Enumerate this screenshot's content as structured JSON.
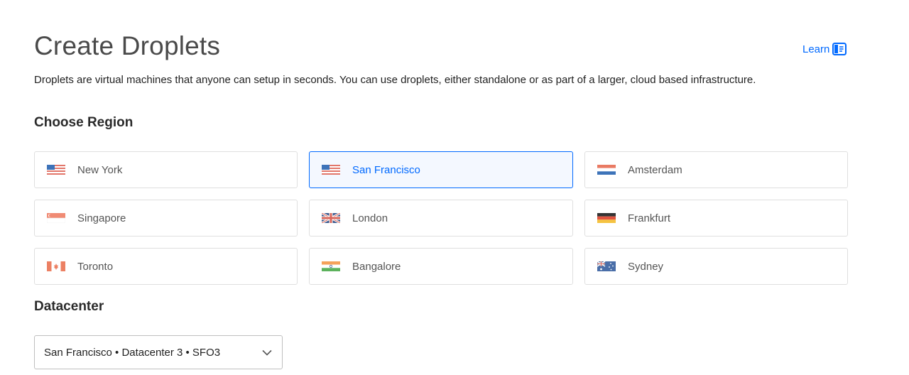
{
  "header": {
    "title": "Create Droplets",
    "learn_label": "Learn",
    "description": "Droplets are virtual machines that anyone can setup in seconds. You can use droplets, either standalone or as part of a larger, cloud based infrastructure."
  },
  "region": {
    "title": "Choose Region",
    "items": [
      {
        "label": "New York",
        "flag": "us-flag",
        "selected": false
      },
      {
        "label": "San Francisco",
        "flag": "us-flag",
        "selected": true
      },
      {
        "label": "Amsterdam",
        "flag": "nl-flag",
        "selected": false
      },
      {
        "label": "Singapore",
        "flag": "sg-flag",
        "selected": false
      },
      {
        "label": "London",
        "flag": "uk-flag",
        "selected": false
      },
      {
        "label": "Frankfurt",
        "flag": "de-flag",
        "selected": false
      },
      {
        "label": "Toronto",
        "flag": "ca-flag",
        "selected": false
      },
      {
        "label": "Bangalore",
        "flag": "in-flag",
        "selected": false
      },
      {
        "label": "Sydney",
        "flag": "au-flag",
        "selected": false
      }
    ]
  },
  "datacenter": {
    "title": "Datacenter",
    "selected": "San Francisco • Datacenter 3 • SFO3"
  },
  "colors": {
    "accent": "#0069ff",
    "selected_bg": "#f4f8ff",
    "border": "#dfdfdf"
  }
}
